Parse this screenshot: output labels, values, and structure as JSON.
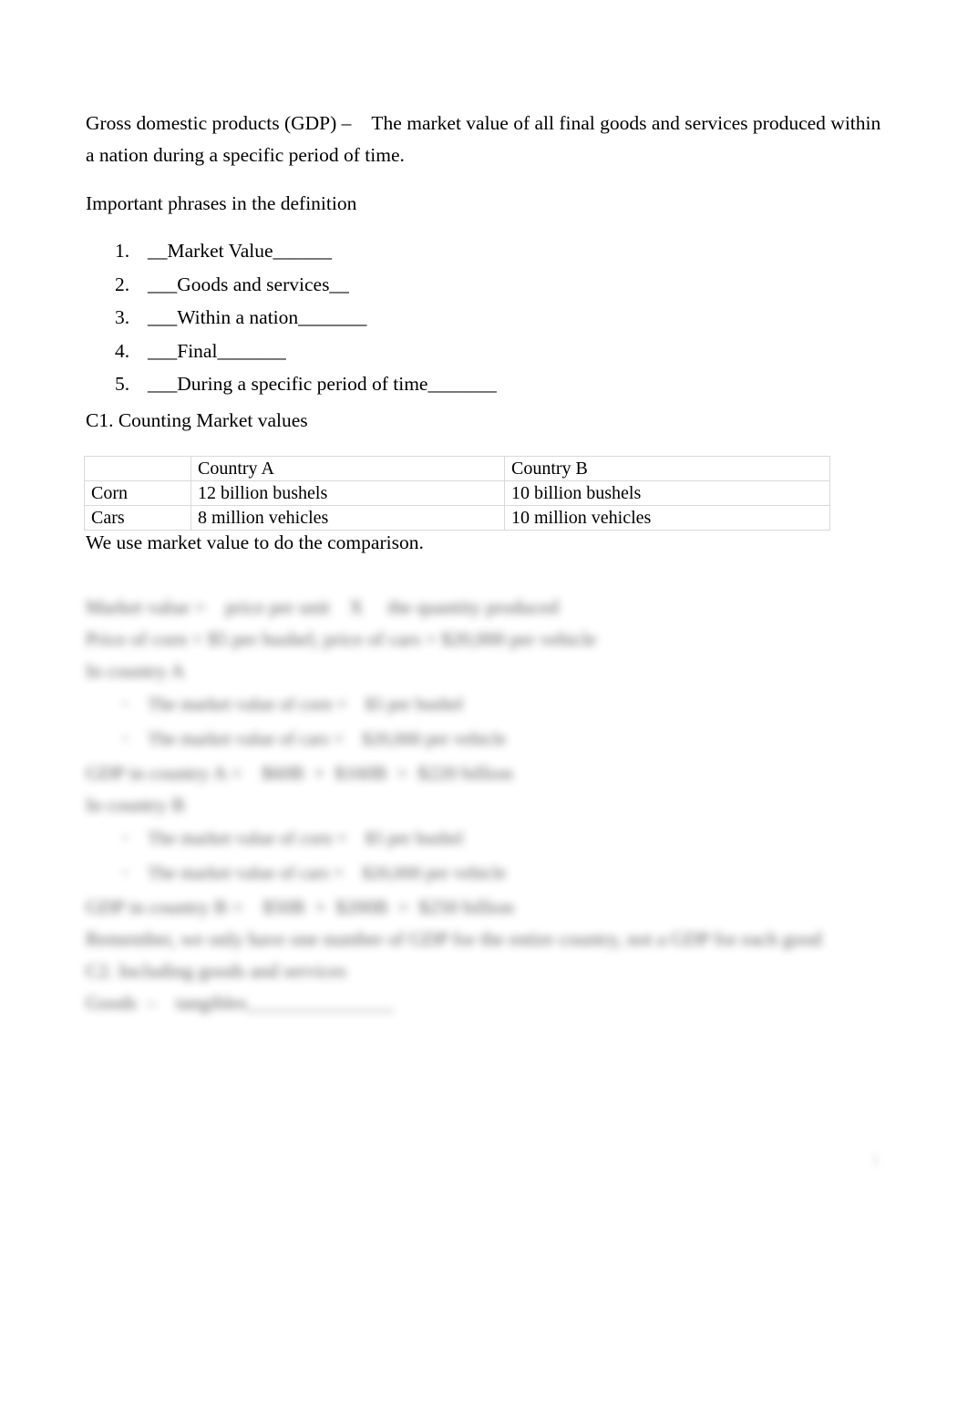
{
  "document": {
    "definition": {
      "term": "Gross domestic products (GDP) –",
      "body": "The market value of all final goods and services produced within a nation during a specific period of time."
    },
    "phrases_heading": "Important phrases in the definition",
    "phrases": [
      {
        "num": "1.",
        "text": "__Market Value______"
      },
      {
        "num": "2.",
        "text": "___Goods and services__"
      },
      {
        "num": "3.",
        "text": "___Within a nation_______"
      },
      {
        "num": "4.",
        "text": "___Final_______"
      },
      {
        "num": "5.",
        "text": "___During a specific period of time_______"
      }
    ],
    "section_c1": "C1. Counting Market values",
    "table": {
      "columns": [
        "",
        "Country A",
        "Country B"
      ],
      "rows": [
        {
          "label": "Corn",
          "country_a": "12 billion bushels",
          "country_b": "10 billion bushels"
        },
        {
          "label": "Cars",
          "country_a": "8 million vehicles",
          "country_b": "10 million vehicles"
        }
      ]
    },
    "comparison_note": "We use market value to do the comparison.",
    "redacted": {
      "formula_line": "Market value =    price per unit    X     the quantity produced",
      "price_line": "Price of corn = $5 per bushel; price of cars = $20,000 per vehicle",
      "country_a_heading": "In country A",
      "country_a_bullets": [
        "The market value of corn =    $5 per bushel",
        "The market value of cars =    $20,000 per vehicle"
      ],
      "country_a_gdp": "GDP in country A =    $60B  +  $160B  =  $220 billion",
      "country_b_heading": "In country B",
      "country_b_bullets": [
        "The market value of corn =    $5 per bushel",
        "The market value of cars =    $20,000 per vehicle"
      ],
      "country_b_gdp": "GDP in country B =    $50B  +  $200B  =  $250 billion",
      "remember_line": "Remember, we only have one number of GDP for the entire country, not a GDP for each good",
      "section_c2": "C2. Including goods and services",
      "goods_line": "Goods  –    tangibles_______________"
    },
    "page_mark": "1"
  }
}
